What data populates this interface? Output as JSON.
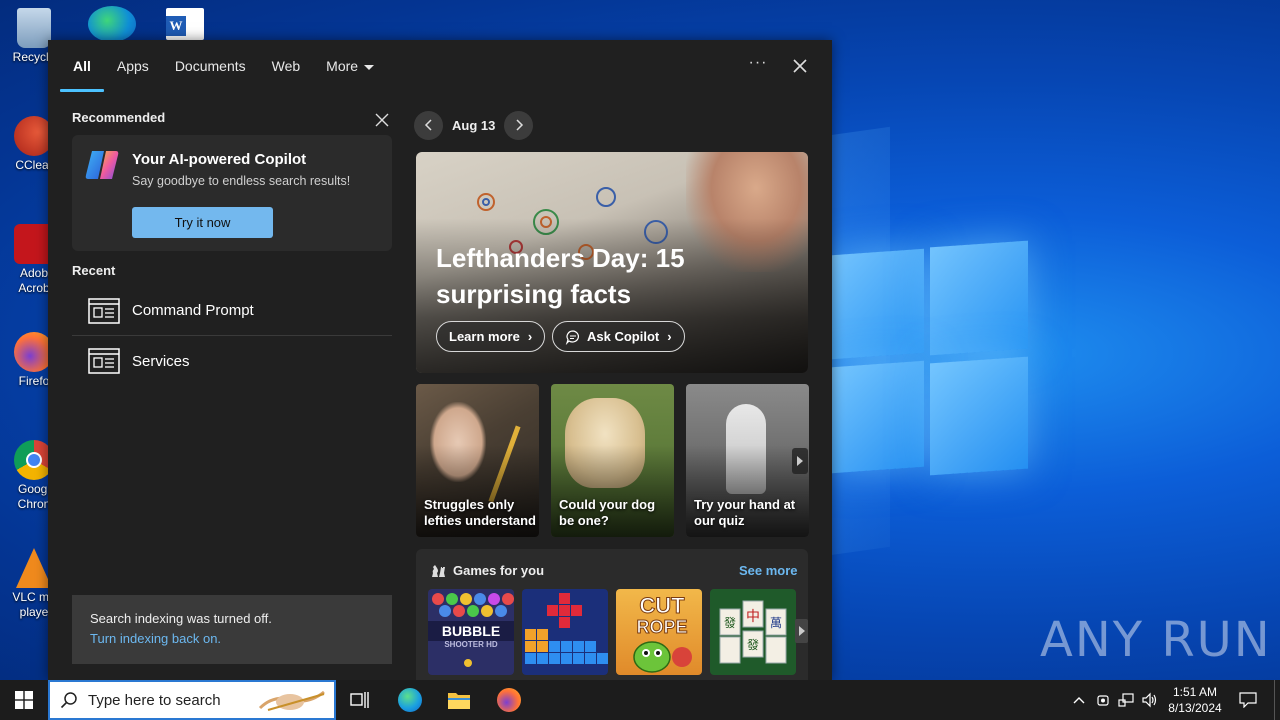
{
  "desktop": {
    "icons": [
      {
        "label": "Recycle",
        "color": "#9ab7d6"
      },
      {
        "label": "CClear",
        "color": "#c8412f"
      },
      {
        "label": "Adob Acrob",
        "color": "#c4161c"
      },
      {
        "label": "Firefo",
        "color": "#ff7139"
      },
      {
        "label": "Googl Chron",
        "color": "#4285f4"
      },
      {
        "label": "VLC me playe",
        "color": "#f08a1d"
      }
    ],
    "watermark": "ANY RUN"
  },
  "search_panel": {
    "tabs": [
      {
        "label": "All",
        "active": true
      },
      {
        "label": "Apps",
        "active": false
      },
      {
        "label": "Documents",
        "active": false
      },
      {
        "label": "Web",
        "active": false
      },
      {
        "label": "More",
        "active": false
      }
    ],
    "more_options": "···",
    "recommended": {
      "label": "Recommended",
      "card_title": "Your AI-powered Copilot",
      "card_subtitle": "Say goodbye to endless search results!",
      "button": "Try it now"
    },
    "recent": {
      "label": "Recent",
      "items": [
        {
          "label": "Command Prompt",
          "icon": "app-window-icon"
        },
        {
          "label": "Services",
          "icon": "app-window-icon"
        }
      ]
    },
    "indexing": {
      "message": "Search indexing was turned off.",
      "link": "Turn indexing back on."
    },
    "highlights": {
      "date": "Aug 13",
      "hero_title": "Lefthanders Day: 15 surprising facts",
      "learn_more": "Learn more",
      "ask_copilot": "Ask Copilot",
      "cards": [
        {
          "caption": "Struggles only lefties understand"
        },
        {
          "caption": "Could your dog be one?"
        },
        {
          "caption": "Try your hand at our quiz"
        }
      ],
      "games": {
        "title": "Games for you",
        "see_more": "See more",
        "items": [
          "Bubble Shooter HD",
          "Block puzzle",
          "Cut the Rope",
          "Mahjong"
        ]
      }
    }
  },
  "taskbar": {
    "search_placeholder": "Type here to search",
    "time": "1:51 AM",
    "date": "8/13/2024"
  },
  "colors": {
    "accent": "#4cc2ff",
    "link": "#6cb8f0",
    "button": "#73b8ee",
    "panel_bg": "#202020"
  }
}
